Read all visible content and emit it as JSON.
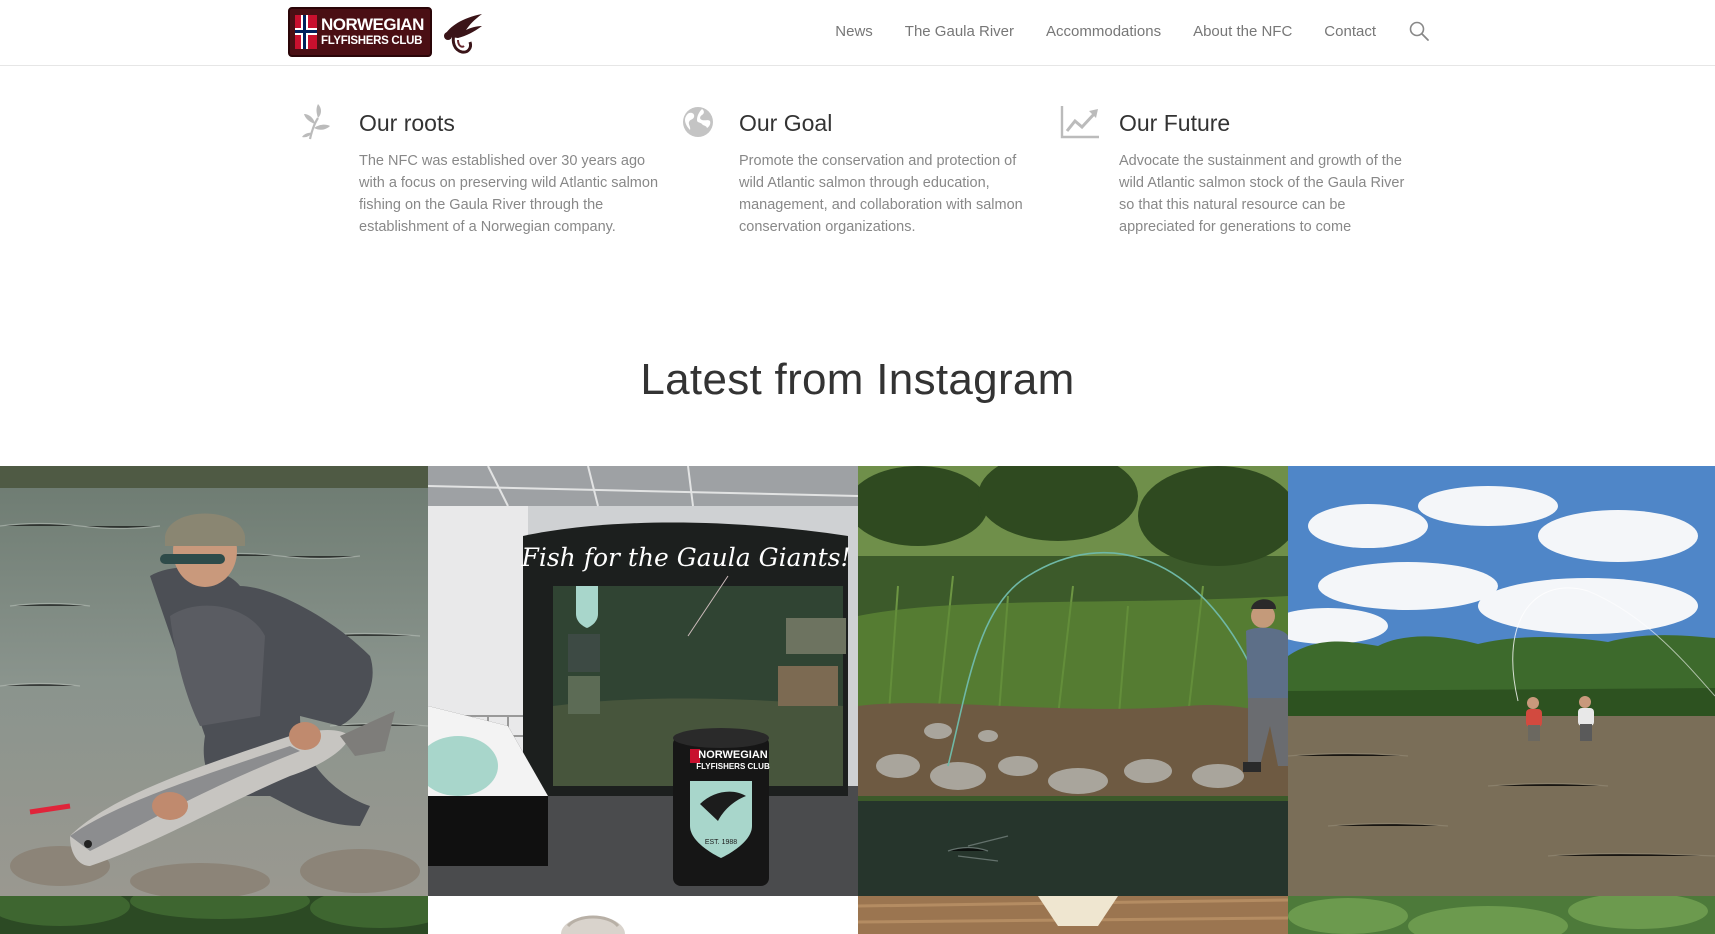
{
  "header": {
    "logo": {
      "line1": "NORWEGIAN",
      "line2": "FLYFISHERS CLUB",
      "icon": "fly-icon"
    },
    "nav": [
      {
        "label": "News"
      },
      {
        "label": "The Gaula River"
      },
      {
        "label": "Accommodations"
      },
      {
        "label": "About the NFC"
      },
      {
        "label": "Contact"
      }
    ],
    "search_icon": "search-icon"
  },
  "features": [
    {
      "icon": "leaf-icon",
      "title": "Our roots",
      "text": "The NFC was established over 30 years ago with a focus on preserving wild Atlantic salmon fishing on the Gaula River through the establishment of a Norwegian company."
    },
    {
      "icon": "globe-icon",
      "title": "Our Goal",
      "text": "Promote the conservation and protection of wild Atlantic salmon through education, management, and collaboration with salmon conservation organizations."
    },
    {
      "icon": "chart-line-icon",
      "title": "Our Future",
      "text": "Advocate the sustainment and growth of the wild Atlantic salmon stock of the Gaula River so that this natural resource can be appreciated for generations to come"
    }
  ],
  "instagram": {
    "title": "Latest from Instagram",
    "banner_text": "Fish for the Gaula Giants!",
    "stand_logo_line1": "NORWEGIAN",
    "stand_logo_line2": "FLYFISHERS CLUB",
    "est_text": "EST. 1988"
  },
  "colors": {
    "brand": "#4a0f14",
    "nav_text": "#777777",
    "body_text": "#888888",
    "heading": "#333333"
  }
}
